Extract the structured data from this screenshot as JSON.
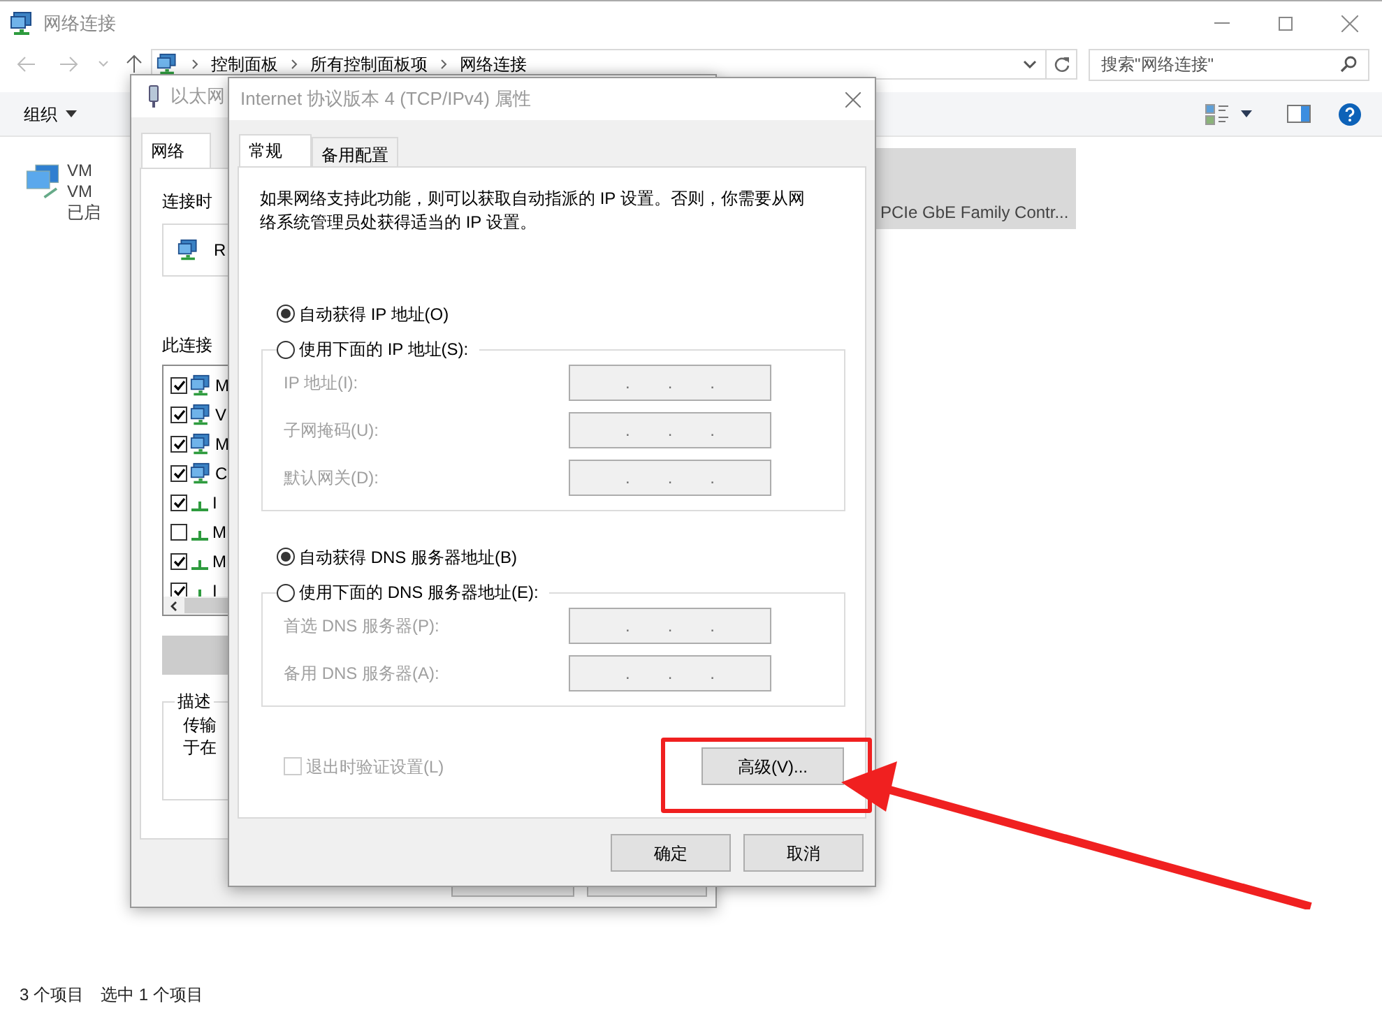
{
  "explorer": {
    "title": "网络连接",
    "breadcrumbs": [
      "控制面板",
      "所有控制面板项",
      "网络连接"
    ],
    "search": {
      "placeholder": "搜索\"网络连接\""
    },
    "toolbar": {
      "organize": "组织"
    },
    "items": [
      {
        "lines": [
          "VM",
          "VM",
          "已启"
        ],
        "selected": false
      },
      {
        "lines": [
          "PCIe GbE Family Contr..."
        ],
        "selected": true
      }
    ],
    "status_bar": [
      "3 个项目",
      "选中 1 个项目"
    ]
  },
  "ethernet_dialog": {
    "title": "以太网",
    "tabs": [
      {
        "label": "网络",
        "selected": true
      }
    ],
    "connect_using_label": "连接时",
    "adapter": "R",
    "components_label": "此连接",
    "components": [
      {
        "name": "M",
        "checked": true,
        "kind": "client"
      },
      {
        "name": "V",
        "checked": true,
        "kind": "client"
      },
      {
        "name": "M",
        "checked": true,
        "kind": "client"
      },
      {
        "name": "C",
        "checked": true,
        "kind": "client"
      },
      {
        "name": "I",
        "checked": true,
        "kind": "protocol"
      },
      {
        "name": "M",
        "checked": false,
        "kind": "protocol"
      },
      {
        "name": "M",
        "checked": true,
        "kind": "protocol"
      },
      {
        "name": "I",
        "checked": true,
        "kind": "protocol"
      }
    ],
    "description_label": "描述",
    "description_lines": [
      "传输",
      "于在"
    ]
  },
  "ipv4_dialog": {
    "title": "Internet 协议版本 4 (TCP/IPv4) 属性",
    "tabs": [
      {
        "label": "常规",
        "selected": true
      },
      {
        "label": "备用配置",
        "selected": false
      }
    ],
    "intro": "如果网络支持此功能，则可以获取自动指派的 IP 设置。否则，你需要从网络系统管理员处获得适当的 IP 设置。",
    "ip_separator": ".",
    "ip_options": [
      {
        "label": "自动获得 IP 地址(O)",
        "selected": true
      },
      {
        "label": "使用下面的 IP 地址(S):",
        "selected": false
      }
    ],
    "ip_fields": [
      {
        "label": "IP 地址(I):",
        "disabled": true
      },
      {
        "label": "子网掩码(U):",
        "disabled": true
      },
      {
        "label": "默认网关(D):",
        "disabled": true
      }
    ],
    "dns_options": [
      {
        "label": "自动获得 DNS 服务器地址(B)",
        "selected": true
      },
      {
        "label": "使用下面的 DNS 服务器地址(E):",
        "selected": false
      }
    ],
    "dns_fields": [
      {
        "label": "首选 DNS 服务器(P):",
        "disabled": true
      },
      {
        "label": "备用 DNS 服务器(A):",
        "disabled": true
      }
    ],
    "validate_on_exit": {
      "label": "退出时验证设置(L)",
      "checked": false,
      "disabled": true
    },
    "advanced_button": "高级(V)...",
    "buttons": [
      "确定",
      "取消"
    ]
  }
}
